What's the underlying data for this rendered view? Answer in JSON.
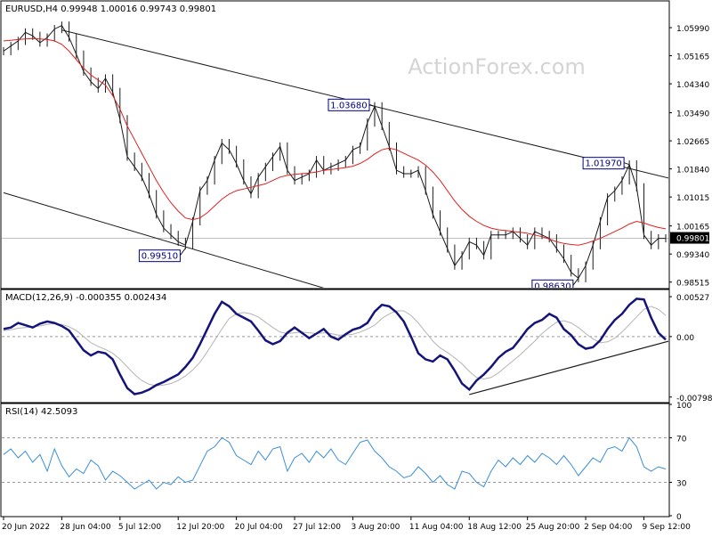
{
  "colors": {
    "background": "#ffffff",
    "price": "#1a1a1a",
    "ema": "#e02020",
    "macd": "#14147a",
    "signal": "#b4b4b4",
    "rsi": "#3a8fd8",
    "channel": "#1a1a1a",
    "level_line": "#c0c0c0",
    "price_tag_bg": "#000000",
    "price_tag_fg": "#ffffff",
    "label_border": "#000080",
    "watermark": "#d4d4d4"
  },
  "watermark": "ActionForex.com",
  "chart_data": [
    {
      "type": "line",
      "id": "price",
      "header": "EURUSD,H4  0.99948 1.00016 0.99743 0.99801",
      "ylim": [
        0.9835,
        1.0675
      ],
      "y_ticks": [
        "1.05990",
        "1.05165",
        "1.04340",
        "1.03490",
        "1.02665",
        "1.01840",
        "1.01015",
        "1.00165",
        "0.99340",
        "0.98515"
      ],
      "y_tick_values": [
        1.0599,
        1.05165,
        1.0434,
        1.0349,
        1.02665,
        1.0184,
        1.01015,
        1.00165,
        0.9934,
        0.98515
      ],
      "current_price": "0.99801",
      "current_price_value": 0.99801,
      "x_labels": [
        "20 Jun 2022",
        "28 Jun 04:00",
        "5 Jul 12:00",
        "12 Jul 20:00",
        "20 Jul 04:00",
        "27 Jul 12:00",
        "3 Aug 20:00",
        "11 Aug 04:00",
        "18 Aug 12:00",
        "25 Aug 20:00",
        "2 Sep 04:00",
        "9 Sep 12:00"
      ],
      "x_label_index": [
        0,
        8,
        16,
        24,
        32,
        40,
        48,
        56,
        64,
        72,
        80,
        88
      ],
      "points": 92,
      "series": [
        {
          "name": "EURUSD",
          "values": [
            1.053,
            1.0545,
            1.056,
            1.0585,
            1.0575,
            1.0555,
            1.057,
            1.0595,
            1.0605,
            1.057,
            1.052,
            1.047,
            1.044,
            1.042,
            1.045,
            1.041,
            1.033,
            1.022,
            1.019,
            1.016,
            1.011,
            1.005,
            1.001,
            0.999,
            0.997,
            0.996,
            1.003,
            1.012,
            1.015,
            1.021,
            1.026,
            1.024,
            1.02,
            1.015,
            1.011,
            1.016,
            1.019,
            1.022,
            1.025,
            1.018,
            1.015,
            1.016,
            1.017,
            1.021,
            1.018,
            1.019,
            1.02,
            1.021,
            1.024,
            1.025,
            1.032,
            1.0368,
            1.031,
            1.025,
            1.018,
            1.017,
            1.017,
            1.018,
            1.012,
            1.005,
            1.0,
            0.995,
            0.99,
            0.993,
            0.997,
            0.996,
            0.993,
            0.999,
            0.999,
            0.999,
            1.0,
            0.998,
            0.996,
            1.0,
            0.999,
            0.998,
            0.995,
            0.992,
            0.988,
            0.9863,
            0.99,
            0.996,
            1.003,
            1.01,
            1.012,
            1.015,
            1.0197,
            1.013,
            0.999,
            0.996,
            0.998,
            0.998
          ]
        },
        {
          "name": "EMA",
          "values": [
            1.056,
            1.0562,
            1.0564,
            1.0566,
            1.0567,
            1.0566,
            1.0564,
            1.056,
            1.055,
            1.053,
            1.0505,
            1.048,
            1.046,
            1.0445,
            1.043,
            1.04,
            1.036,
            1.031,
            1.027,
            1.023,
            1.019,
            1.015,
            1.0115,
            1.0085,
            1.006,
            1.004,
            1.0035,
            1.004,
            1.0055,
            1.0075,
            1.0095,
            1.011,
            1.012,
            1.0125,
            1.013,
            1.0135,
            1.014,
            1.015,
            1.016,
            1.0165,
            1.0168,
            1.017,
            1.0172,
            1.0175,
            1.018,
            1.0182,
            1.0185,
            1.0188,
            1.0192,
            1.02,
            1.0212,
            1.0228,
            1.024,
            1.0245,
            1.024,
            1.023,
            1.022,
            1.021,
            1.0195,
            1.0175,
            1.015,
            1.012,
            1.009,
            1.0065,
            1.0045,
            1.003,
            1.0018,
            1.001,
            1.0005,
            1.0003,
            1.0,
            0.9998,
            0.9995,
            0.999,
            0.9985,
            0.9978,
            0.997,
            0.9965,
            0.9962,
            0.996,
            0.9965,
            0.9972,
            0.998,
            0.999,
            1.0,
            1.001,
            1.0022,
            1.003,
            1.0025,
            1.0018,
            1.0012,
            1.0008
          ]
        }
      ],
      "annotations": [
        {
          "text": "1.03680",
          "index": 51,
          "value": 1.0368
        },
        {
          "text": "0.99510",
          "index": 25,
          "value": 0.9951
        },
        {
          "text": "1.01970",
          "index": 86,
          "value": 1.0197
        },
        {
          "text": "0.98630",
          "index": 79,
          "value": 0.9863
        }
      ],
      "trendlines": [
        {
          "name": "channel-upper",
          "from": [
            8,
            1.0592
          ],
          "to": [
            92,
            1.0154
          ]
        },
        {
          "name": "channel-lower",
          "from": [
            0,
            1.0114
          ],
          "to": [
            44,
            0.9834
          ]
        }
      ]
    },
    {
      "type": "line",
      "id": "macd",
      "header": "MACD(12,26,9) -0.000355 0.002434",
      "ylim": [
        -0.0086,
        0.0061
      ],
      "y_ticks": [
        "0.00527",
        "0.00",
        "-0.007984"
      ],
      "y_tick_values": [
        0.00527,
        0.0,
        -0.007984
      ],
      "current_value": "0.00",
      "series": [
        {
          "name": "MACD",
          "values": [
            0.001,
            0.0012,
            0.0018,
            0.0015,
            0.0012,
            0.0017,
            0.002,
            0.0018,
            0.0014,
            0.0008,
            -0.0005,
            -0.0018,
            -0.0025,
            -0.002,
            -0.0022,
            -0.003,
            -0.005,
            -0.0068,
            -0.0076,
            -0.0074,
            -0.007,
            -0.0064,
            -0.006,
            -0.0055,
            -0.005,
            -0.004,
            -0.0028,
            -0.001,
            0.001,
            0.003,
            0.0046,
            0.004,
            0.003,
            0.0025,
            0.002,
            0.0008,
            -0.0005,
            -0.001,
            -0.0006,
            0.0005,
            0.0012,
            0.0005,
            -0.0002,
            0.0004,
            0.001,
            0.0,
            -0.0004,
            0.0003,
            0.0009,
            0.0012,
            0.0018,
            0.0033,
            0.0042,
            0.004,
            0.0032,
            0.002,
            0.0,
            -0.0022,
            -0.003,
            -0.0033,
            -0.0025,
            -0.003,
            -0.0045,
            -0.0062,
            -0.007,
            -0.0058,
            -0.005,
            -0.004,
            -0.0028,
            -0.002,
            -0.0015,
            -0.0003,
            0.001,
            0.0018,
            0.0022,
            0.003,
            0.0025,
            0.001,
            0.0002,
            -0.001,
            -0.0016,
            -0.0014,
            -0.0005,
            0.001,
            0.0022,
            0.003,
            0.0042,
            0.005,
            0.0049,
            0.0025,
            0.0005,
            -0.0004
          ]
        },
        {
          "name": "Signal",
          "values": [
            0.0008,
            0.0009,
            0.0011,
            0.0012,
            0.0013,
            0.0014,
            0.0016,
            0.0017,
            0.0016,
            0.0013,
            0.0008,
            0.0,
            -0.0008,
            -0.0013,
            -0.0017,
            -0.0022,
            -0.003,
            -0.004,
            -0.005,
            -0.0058,
            -0.0063,
            -0.0065,
            -0.0064,
            -0.0062,
            -0.0058,
            -0.0052,
            -0.0044,
            -0.0034,
            -0.002,
            -0.0005,
            0.001,
            0.0024,
            0.003,
            0.0032,
            0.003,
            0.0026,
            0.0019,
            0.0012,
            0.0006,
            0.0004,
            0.0005,
            0.0006,
            0.0005,
            0.0004,
            0.0005,
            0.0004,
            0.0002,
            0.0002,
            0.0003,
            0.0006,
            0.001,
            0.0015,
            0.0024,
            0.003,
            0.0034,
            0.0034,
            0.0028,
            0.0018,
            0.0006,
            -0.0006,
            -0.0015,
            -0.0021,
            -0.0028,
            -0.0036,
            -0.0046,
            -0.0054,
            -0.0056,
            -0.0054,
            -0.0048,
            -0.004,
            -0.0032,
            -0.0024,
            -0.0015,
            -0.0006,
            0.0004,
            0.0012,
            0.0019,
            0.0021,
            0.0018,
            0.0012,
            0.0004,
            -0.0003,
            -0.0008,
            -0.0007,
            -0.0002,
            0.0006,
            0.0016,
            0.0026,
            0.0036,
            0.004,
            0.0036,
            0.0028
          ]
        }
      ],
      "trendlines": [
        {
          "name": "macd-support",
          "from": [
            64,
            -0.00765
          ],
          "to": [
            92,
            -0.00045
          ]
        }
      ]
    },
    {
      "type": "line",
      "id": "rsi",
      "header": "RSI(14) 42.5093",
      "ylim": [
        0,
        100
      ],
      "y_ticks": [
        "100",
        "70",
        "30",
        "0"
      ],
      "y_tick_values": [
        100,
        70,
        30,
        0
      ],
      "levels": [
        70,
        30
      ],
      "series": [
        {
          "name": "RSI",
          "values": [
            55,
            60,
            52,
            58,
            48,
            55,
            40,
            60,
            45,
            35,
            42,
            38,
            50,
            45,
            32,
            40,
            36,
            30,
            24,
            28,
            32,
            24,
            30,
            28,
            35,
            30,
            32,
            45,
            58,
            62,
            70,
            66,
            54,
            50,
            46,
            58,
            50,
            60,
            62,
            40,
            52,
            56,
            48,
            58,
            52,
            60,
            50,
            46,
            56,
            66,
            68,
            58,
            52,
            44,
            40,
            34,
            36,
            44,
            38,
            30,
            36,
            28,
            24,
            40,
            38,
            30,
            26,
            40,
            50,
            44,
            52,
            46,
            54,
            48,
            56,
            52,
            46,
            54,
            46,
            36,
            44,
            52,
            48,
            60,
            62,
            58,
            70,
            62,
            44,
            40,
            44,
            42
          ]
        }
      ]
    }
  ]
}
